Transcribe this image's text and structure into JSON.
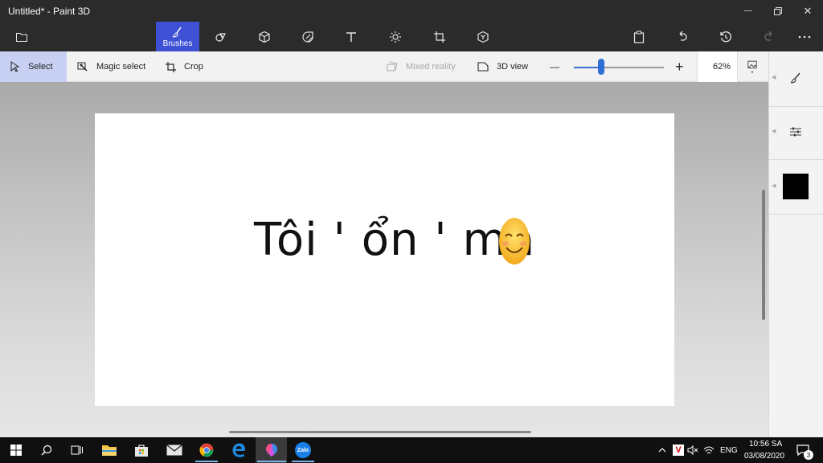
{
  "window": {
    "title": "Untitled* - Paint 3D",
    "minimize_glyph": "—",
    "close_glyph": "✕"
  },
  "commandbar": {
    "brushes_label": "Brushes"
  },
  "toolbar": {
    "select_label": "Select",
    "magic_select_label": "Magic select",
    "crop_label": "Crop",
    "mixed_reality_label": "Mixed reality",
    "view3d_label": "3D view",
    "zoom_minus": "—",
    "zoom_plus": "+",
    "zoom_value": "62%",
    "zoom_fraction": 0.3
  },
  "canvas": {
    "text": "Tôi ' ổn ' mà"
  },
  "colors": {
    "accent": "#3f52d6",
    "select_highlight": "#c7d0f2",
    "active_color": "#000000"
  },
  "taskbar": {
    "lang": "ENG",
    "time": "10:56 SA",
    "date": "03/08/2020",
    "notifications": "3",
    "zalo_label": "Zalo"
  }
}
